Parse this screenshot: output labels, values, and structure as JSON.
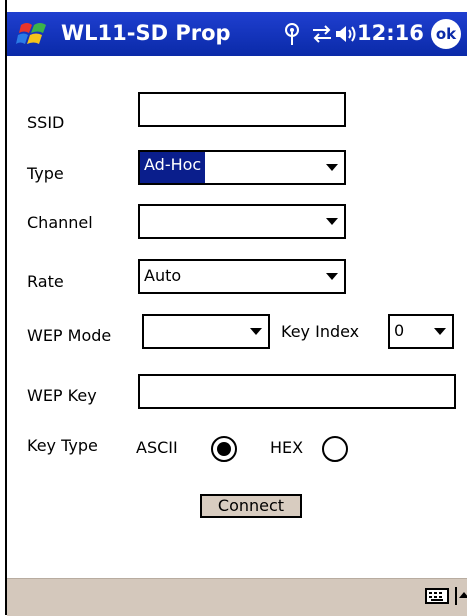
{
  "titlebar": {
    "title": "WL11-SD Prop",
    "time": "12:16",
    "ok_label": "ok"
  },
  "form": {
    "ssid": {
      "label": "SSID",
      "value": ""
    },
    "type": {
      "label": "Type",
      "value": "Ad-Hoc"
    },
    "channel": {
      "label": "Channel",
      "value": ""
    },
    "rate": {
      "label": "Rate",
      "value": "Auto"
    },
    "wep_mode": {
      "label": "WEP Mode",
      "value": ""
    },
    "key_index": {
      "label": "Key Index",
      "value": "0"
    },
    "wep_key": {
      "label": "WEP Key",
      "value": ""
    },
    "key_type": {
      "label": "Key Type",
      "options": [
        {
          "label": "ASCII",
          "selected": true
        },
        {
          "label": "HEX",
          "selected": false
        }
      ]
    },
    "connect_label": "Connect"
  },
  "colors": {
    "titlebar": "#0a2aa8",
    "highlight": "#0a1e8c",
    "bottombar": "#d4c8bc",
    "button": "#d8ccc0"
  },
  "icons": {
    "start": "windows-flag-icon",
    "signal": "antenna-icon",
    "connectivity": "connectivity-arrows-icon",
    "volume": "speaker-icon",
    "keyboard": "keyboard-icon",
    "sip": "sip-up-arrow-icon"
  }
}
